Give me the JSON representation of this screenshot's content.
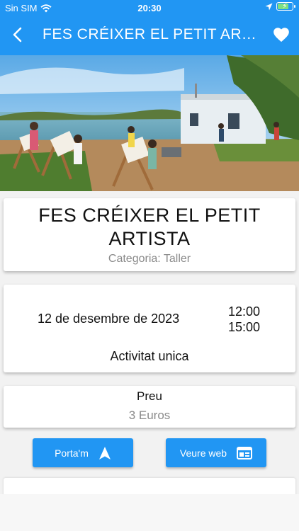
{
  "status": {
    "carrier": "Sin SIM",
    "time": "20:30"
  },
  "appbar": {
    "title": "FES CRÉIXER EL PETIT ARTISTA"
  },
  "event": {
    "title": "FES CRÉIXER EL PETIT ARTISTA",
    "category": "Categoria: Taller",
    "date": "12 de desembre de 2023",
    "start_time": "12:00",
    "end_time": "15:00",
    "frequency": "Activitat unica",
    "price_label": "Preu",
    "price_value": "3 Euros"
  },
  "actions": {
    "navigate_label": "Porta'm",
    "web_label": "Veure web"
  },
  "icons": {
    "back": "back-arrow-icon",
    "favorite": "heart-icon",
    "navigate": "navigation-arrow-icon",
    "web": "web-window-icon"
  },
  "colors": {
    "primary": "#2196f3",
    "background": "#f2f2f2"
  }
}
